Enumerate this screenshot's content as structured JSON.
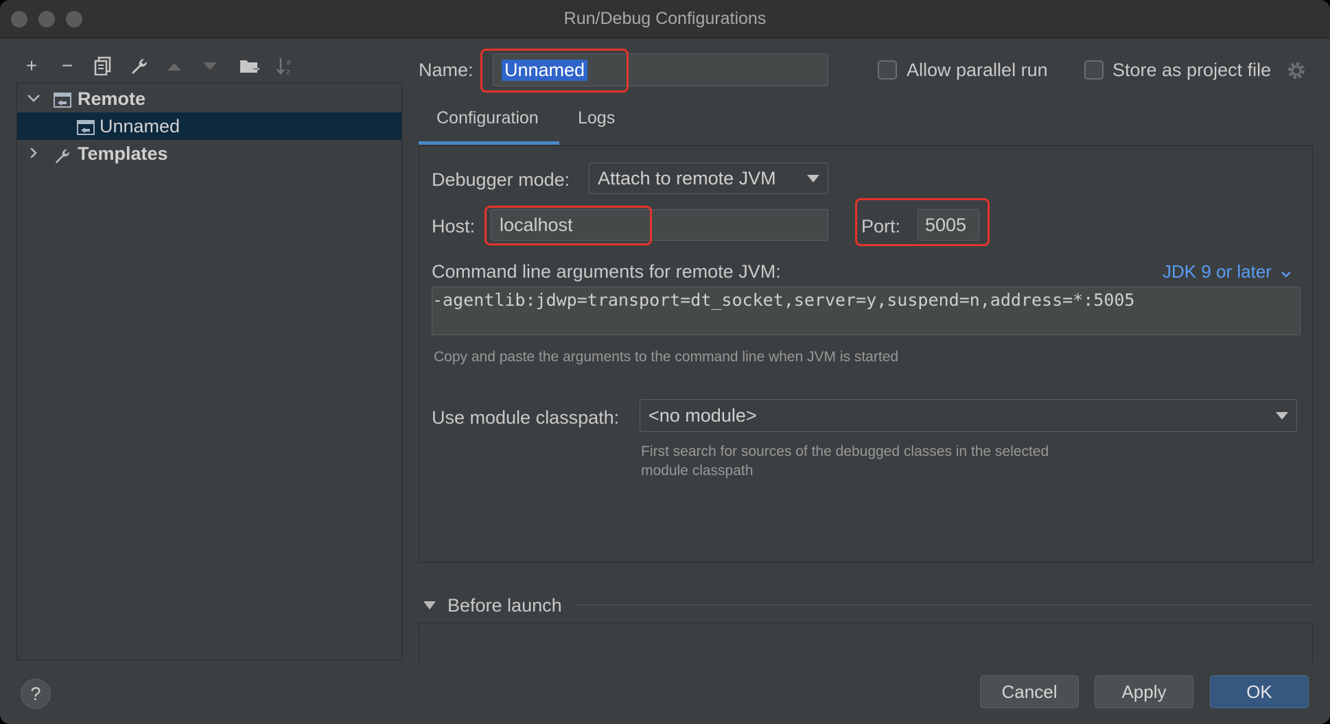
{
  "window": {
    "title": "Run/Debug Configurations"
  },
  "toolbar": {
    "add": "+",
    "remove": "−",
    "copy_icon": "copy-icon",
    "wrench_icon": "wrench-icon",
    "up_icon": "arrow-up-icon",
    "down_icon": "arrow-down-icon",
    "folder_icon": "new-folder-icon",
    "sort_icon": "sort-icon"
  },
  "tree": {
    "items": [
      {
        "label": "Remote",
        "expanded": true
      },
      {
        "label": "Unnamed",
        "selected": true
      },
      {
        "label": "Templates",
        "expanded": false
      }
    ]
  },
  "header": {
    "name_label": "Name:",
    "name_value": "Unnamed",
    "allow_parallel": "Allow parallel run",
    "store_as_project": "Store as project file"
  },
  "tabs": [
    {
      "label": "Configuration",
      "active": true
    },
    {
      "label": "Logs",
      "active": false
    }
  ],
  "config": {
    "debugger_mode_label": "Debugger mode:",
    "debugger_mode_value": "Attach to remote JVM",
    "host_label": "Host:",
    "host_value": "localhost",
    "port_label": "Port:",
    "port_value": "5005",
    "cmd_label": "Command line arguments for remote JVM:",
    "jdk_link": "JDK 9 or later",
    "cmd_value": "-agentlib:jdwp=transport=dt_socket,server=y,suspend=n,address=*:5005",
    "cmd_hint": "Copy and paste the arguments to the command line when JVM is started",
    "module_label": "Use module classpath:",
    "module_value": "<no module>",
    "module_hint_line1": "First search for sources of the debugged classes in the selected",
    "module_hint_line2": "module classpath"
  },
  "before_launch": {
    "label": "Before launch"
  },
  "buttons": {
    "help": "?",
    "cancel": "Cancel",
    "apply": "Apply",
    "ok": "OK"
  },
  "colors": {
    "accent": "#4a88c7",
    "highlight": "#e3352a",
    "link": "#589df6",
    "selection": "#0d293e"
  }
}
